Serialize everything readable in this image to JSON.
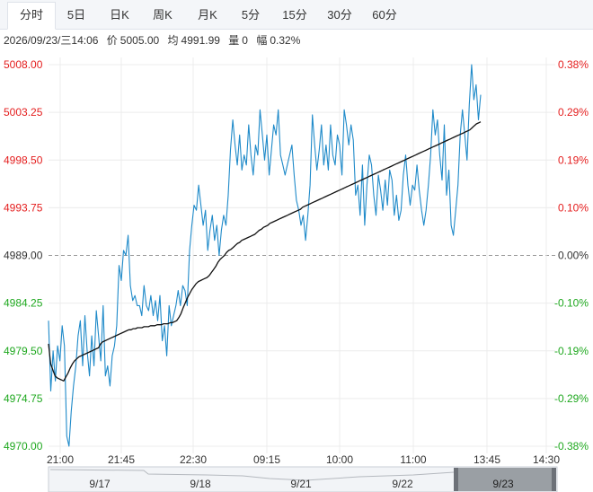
{
  "tabs": [
    {
      "label": "分时",
      "active": true
    },
    {
      "label": "5日",
      "active": false
    },
    {
      "label": "日K",
      "active": false
    },
    {
      "label": "周K",
      "active": false
    },
    {
      "label": "月K",
      "active": false
    },
    {
      "label": "5分",
      "active": false
    },
    {
      "label": "15分",
      "active": false
    },
    {
      "label": "30分",
      "active": false
    },
    {
      "label": "60分",
      "active": false
    }
  ],
  "info": {
    "datetime": "2026/09/23/三14:06",
    "price_label": "价",
    "price": "5005.00",
    "avg_label": "均",
    "avg": "4991.99",
    "vol_label": "量",
    "vol": "0",
    "range_label": "幅",
    "range": "0.32%"
  },
  "colors": {
    "price_line": "#1f8ac9",
    "avg_line": "#111111",
    "up": "#e41e1e",
    "down": "#1fa81f",
    "neutral": "#333333",
    "grid": "#ececec",
    "baseline": "#999999"
  },
  "chart_data": {
    "type": "line",
    "series": [
      {
        "values": [
          4982.5,
          4975.5,
          4979.5,
          4976.5,
          4980.0,
          4978.5,
          4982.0,
          4980.0,
          4971.0,
          4970.0,
          4973.5,
          4976.0,
          4978.0,
          4981.0,
          4982.5,
          4978.0,
          4983.0,
          4979.5,
          4977.0,
          4981.0,
          4978.0,
          4983.5,
          4981.0,
          4978.5,
          4984.0,
          4977.0,
          4978.0,
          4976.0,
          4979.0,
          4980.0,
          4982.0,
          4988.0,
          4986.5,
          4989.5,
          4989.0,
          4991.0,
          4986.0,
          4984.5,
          4985.0,
          4984.0,
          4984.0,
          4983.0,
          4986.0,
          4984.0,
          4983.5,
          4985.0,
          4983.0,
          4984.5,
          4982.5,
          4985.0,
          4980.5,
          4982.0,
          4979.0,
          4984.0,
          4982.0,
          4983.0,
          4984.0,
          4985.5,
          4984.0,
          4986.0,
          4985.5,
          4984.0,
          4989.5,
          4992.0,
          4994.0,
          4993.5,
          4996.0,
          4994.0,
          4992.0,
          4993.5,
          4989.5,
          4991.5,
          4993.0,
          4990.5,
          4992.0,
          4989.0,
          4991.5,
          4993.0,
          4992.0,
          4995.0,
          4999.5,
          5002.5,
          5000.0,
          4998.0,
          5001.0,
          4997.5,
          4999.0,
          4998.0,
          5002.0,
          4999.0,
          4997.0,
          5000.0,
          4999.0,
          5003.5,
          5001.0,
          4998.5,
          5001.0,
          4997.0,
          4999.5,
          5002.0,
          5001.0,
          5003.5,
          4999.0,
          4998.0,
          4997.0,
          4998.0,
          4999.0,
          5000.0,
          4997.0,
          4994.5,
          4993.5,
          4992.0,
          4993.0,
          4990.5,
          4993.0,
          4996.0,
          5003.0,
          5000.0,
          4997.5,
          4999.5,
          5002.0,
          4998.0,
          5000.0,
          4997.5,
          5002.0,
          4999.0,
          4998.0,
          5001.0,
          5000.0,
          4997.0,
          5003.5,
          5002.0,
          5000.0,
          5002.0,
          5000.5,
          4995.0,
          4996.0,
          4993.0,
          4998.0,
          4992.0,
          4996.0,
          4999.0,
          4998.0,
          4995.0,
          4993.0,
          4997.0,
          4995.5,
          4993.5,
          4996.5,
          4994.0,
          4997.5,
          4996.5,
          4993.0,
          4995.0,
          4992.5,
          4993.5,
          4997.0,
          4999.0,
          4996.0,
          4994.0,
          4996.0,
          4995.5,
          4998.0,
          4995.5,
          4993.5,
          4992.0,
          4993.5,
          4996.0,
          4999.0,
          5003.5,
          5001.0,
          5002.5,
          4999.0,
          4996.5,
          5002.0,
          4995.0,
          4997.5,
          4992.0,
          4991.0,
          4993.5,
          4996.0,
          5001.0,
          5003.5,
          5001.0,
          4998.5,
          5004.0,
          5008.0,
          5004.5,
          5006.0,
          5002.5,
          5005.0
        ],
        "color": "#1f8ac9"
      },
      {
        "values": [
          4980.2,
          4978.2,
          4977.6,
          4977.0,
          4976.8,
          4976.7,
          4976.6,
          4976.5,
          4976.9,
          4977.3,
          4977.8,
          4978.2,
          4978.5,
          4978.7,
          4978.9,
          4979.0,
          4979.1,
          4979.2,
          4979.3,
          4979.4,
          4979.5,
          4979.6,
          4979.7,
          4979.8,
          4980.2,
          4980.4,
          4980.5,
          4980.6,
          4980.7,
          4980.8,
          4980.9,
          4981.0,
          4981.1,
          4981.2,
          4981.3,
          4981.4,
          4981.5,
          4981.6,
          4981.6,
          4981.7,
          4981.7,
          4981.8,
          4981.8,
          4981.8,
          4981.9,
          4981.9,
          4981.9,
          4982.0,
          4982.0,
          4982.0,
          4982.1,
          4982.1,
          4982.1,
          4982.2,
          4982.2,
          4982.2,
          4982.3,
          4982.3,
          4982.4,
          4982.5,
          4982.8,
          4983.2,
          4983.8,
          4984.3,
          4984.8,
          4985.2,
          4985.6,
          4985.9,
          4986.2,
          4986.4,
          4986.5,
          4986.6,
          4986.7,
          4986.8,
          4987.0,
          4987.3,
          4987.6,
          4987.9,
          4988.3,
          4988.6,
          4988.8,
          4989.0,
          4989.3,
          4989.5,
          4989.6,
          4989.8,
          4990.0,
          4990.2,
          4990.3,
          4990.5,
          4990.6,
          4990.7,
          4990.8,
          4990.9,
          4991.0,
          4991.1,
          4991.3,
          4991.5,
          4991.6,
          4991.8,
          4991.9,
          4992.0,
          4992.2,
          4992.3,
          4992.4,
          4992.5,
          4992.6,
          4992.7,
          4992.8,
          4992.9,
          4993.0,
          4993.1,
          4993.2,
          4993.3,
          4993.4,
          4993.5,
          4993.6,
          4993.8,
          4993.9,
          4994.0,
          4994.1,
          4994.2,
          4994.3,
          4994.4,
          4994.5,
          4994.6,
          4994.7,
          4994.8,
          4994.9,
          4995.0,
          4995.1,
          4995.2,
          4995.3,
          4995.4,
          4995.5,
          4995.6,
          4995.7,
          4995.8,
          4995.9,
          4996.0,
          4996.1,
          4996.2,
          4996.3,
          4996.4,
          4996.5,
          4996.6,
          4996.7,
          4996.8,
          4996.9,
          4997.0,
          4997.1,
          4997.2,
          4997.3,
          4997.4,
          4997.5,
          4997.6,
          4997.7,
          4997.8,
          4997.9,
          4998.0,
          4998.1,
          4998.2,
          4998.3,
          4998.4,
          4998.5,
          4998.6,
          4998.7,
          4998.8,
          4998.9,
          4999.0,
          4999.1,
          4999.2,
          4999.3,
          4999.4,
          4999.5,
          4999.6,
          4999.7,
          4999.8,
          4999.9,
          5000.0,
          5000.1,
          5000.2,
          5000.3,
          5000.4,
          5000.5,
          5000.6,
          5000.7,
          5000.8,
          5000.9,
          5001.0,
          5001.1,
          5001.2,
          5001.3,
          5001.4,
          5001.5,
          5001.7,
          5001.9,
          5002.1,
          5002.2,
          5002.3
        ],
        "color": "#111111"
      }
    ],
    "ylim": [
      4970.0,
      5008.0
    ],
    "baseline": 4989.0,
    "y_ticks_left": [
      "5008.00",
      "5003.25",
      "4998.50",
      "4993.75",
      "4989.00",
      "4984.25",
      "4979.50",
      "4974.75",
      "4970.00"
    ],
    "y_ticks_right": [
      "0.38%",
      "0.29%",
      "0.19%",
      "0.10%",
      "0.00%",
      "-0.10%",
      "-0.19%",
      "-0.29%",
      "-0.38%"
    ],
    "x_ticks": [
      "21:00",
      "21:45",
      "22:30",
      "09:15",
      "10:00",
      "11:00",
      "13:45",
      "14:30"
    ],
    "grid": true
  },
  "navigator": {
    "dates": [
      "9/17",
      "9/18",
      "9/21",
      "9/22",
      "9/23"
    ],
    "selected": "9/23"
  }
}
